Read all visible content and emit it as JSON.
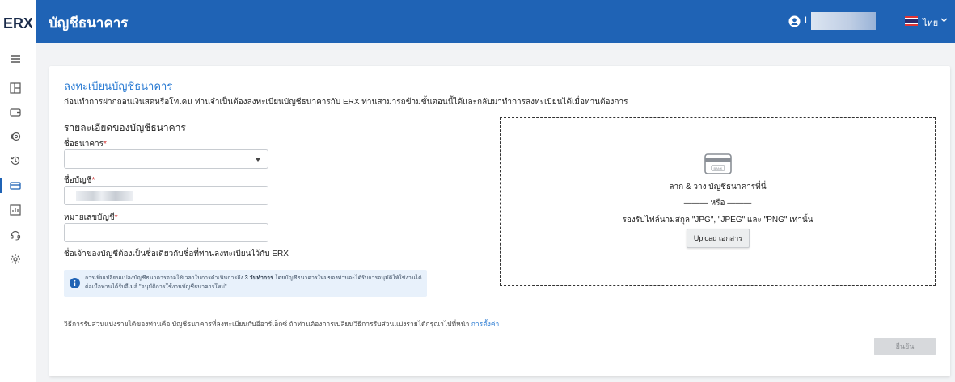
{
  "app": {
    "logo_text": "ERX"
  },
  "sidebar": {
    "items": [
      {
        "icon": "menu-icon"
      },
      {
        "icon": "dashboard-icon"
      },
      {
        "icon": "wallet-icon"
      },
      {
        "icon": "coins-icon"
      },
      {
        "icon": "history-icon"
      },
      {
        "icon": "bank-card-icon",
        "active": true
      },
      {
        "icon": "chart-icon"
      },
      {
        "icon": "headset-icon"
      },
      {
        "icon": "gear-icon"
      }
    ]
  },
  "header": {
    "title": "บัญชีธนาคาร",
    "user_initial": "I",
    "language": "ไทย"
  },
  "form": {
    "title": "ลงทะเบียนบัญชีธนาคาร",
    "description": "ก่อนทำการฝากถอนเงินสดหรือโทเคน ท่านจำเป็นต้องลงทะเบียนบัญชีธนาคารกับ ERX ท่านสามารถข้ามขั้นตอนนี้ได้และกลับมาทำการลงทะเบียนได้เมื่อท่านต้องการ",
    "section_title": "รายละเอียดของบัญชีธนาคาร",
    "bank_label": "ชื่อธนาคาร",
    "account_name_label": "ชื่อบัญชี",
    "account_number_label": "หมายเลขบัญชี",
    "required_mark": "*",
    "owner_note": "ชื่อเจ้าของบัญชีต้องเป็นชื่อเดียวกับชื่อที่ท่านลงทะเบียนไว้กับ ERX",
    "info_text_1": "การเพิ่มเปลี่ยนแปลงบัญชีธนาคารอาจใช้เวลาในการดำเนินการถึง ",
    "info_bold": "3 วันทำการ",
    "info_text_2": " โดยบัญชีธนาคารใหม่ของท่านจะได้รับการอนุมัติให้ใช้งานได้ต่อเมื่อท่านได้รับอีเมล์ \"อนุมัติการใช้งานบัญชีธนาคารใหม่\"",
    "bottom_note": "วิธีการรับส่วนแบ่งรายได้ของท่านคือ บัญชีธนาคารที่ลงทะเบียนกับอีอาร์เอ็กซ์ ถ้าท่านต้องการเปลี่ยนวิธีการรับส่วนแบ่งรายได้กรุณาไปที่หน้า ",
    "settings_link": "การตั้งค่า",
    "confirm_button": "ยืนยัน"
  },
  "dropzone": {
    "bank_card_text": "BANK",
    "drag_text": "ลาก & วาง บัญชีธนาคารที่นี่",
    "or_text": "——— หรือ ———",
    "formats_text": "รองรับไฟล์นามสกุล \"JPG\", \"JPEG\" และ \"PNG\" เท่านั้น",
    "upload_button": "Upload เอกสาร"
  },
  "colors": {
    "primary": "#1f63b5",
    "link": "#2a7bd3",
    "required": "#d32f2f",
    "info_bg": "#e8f1fb"
  }
}
